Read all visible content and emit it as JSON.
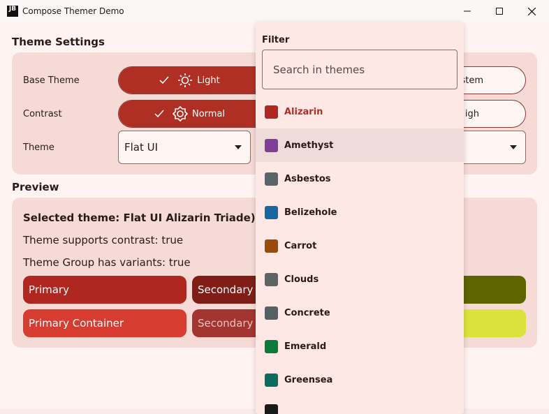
{
  "window": {
    "title": "Compose Themer Demo",
    "icon_text": "JB"
  },
  "settings": {
    "title": "Theme Settings",
    "base_theme": {
      "label": "Base Theme",
      "selected": "Light",
      "partial_option": "stem"
    },
    "contrast": {
      "label": "Contrast",
      "selected": "Normal",
      "partial_option": "igh"
    },
    "theme": {
      "label": "Theme",
      "value": "Flat UI"
    }
  },
  "preview": {
    "title": "Preview",
    "selected_theme": "Selected theme: Flat UI Alizarin Triade)",
    "supports_contrast": "Theme supports contrast: true",
    "has_variants": "Theme Group has variants: true",
    "chips": {
      "primary": "Primary",
      "secondary": "Secondary",
      "primary_container": "Primary Container",
      "secondary_container": "Secondary C"
    }
  },
  "dropdown": {
    "filter_label": "Filter",
    "search_placeholder": "Search in themes",
    "items": [
      {
        "label": "Alizarin",
        "color": "#b02620",
        "selected": true
      },
      {
        "label": "Amethyst",
        "color": "#7d3f98",
        "highlighted": true
      },
      {
        "label": "Asbestos",
        "color": "#5b6468"
      },
      {
        "label": "Belizehole",
        "color": "#1867a0"
      },
      {
        "label": "Carrot",
        "color": "#9a4a0b"
      },
      {
        "label": "Clouds",
        "color": "#5f6366"
      },
      {
        "label": "Concrete",
        "color": "#566063"
      },
      {
        "label": "Emerald",
        "color": "#0c7a3a"
      },
      {
        "label": "Greensea",
        "color": "#0b6b5c"
      }
    ]
  },
  "colors": {
    "primary": "#b02620",
    "secondary": "#7f1d16",
    "primary_container": "#d63d30",
    "secondary_container": "#a33530",
    "tertiary": "#5e6400",
    "tertiary_container": "#dbe23c",
    "surface_variant": "#f6dad6",
    "background": "#fff4f2"
  }
}
